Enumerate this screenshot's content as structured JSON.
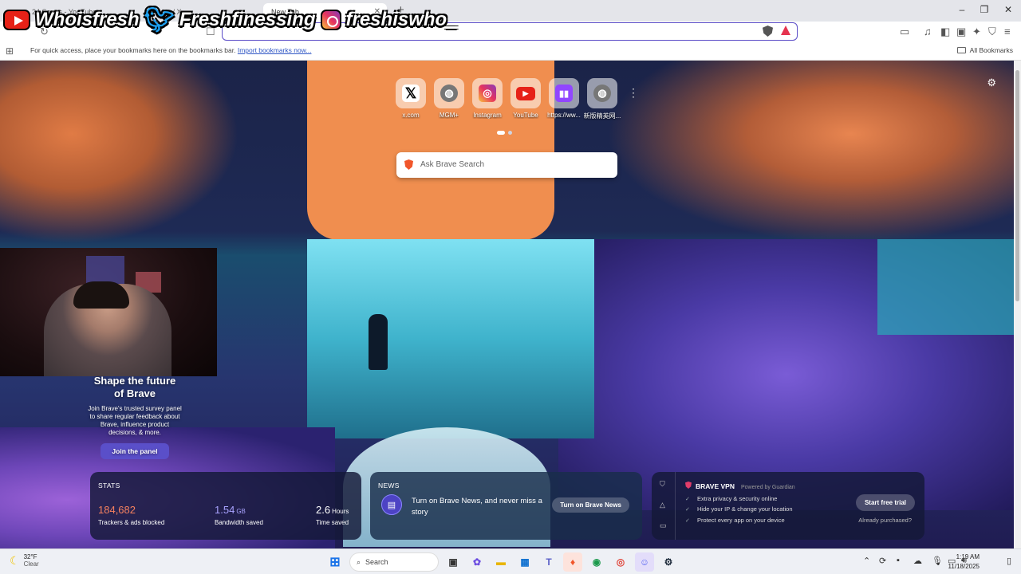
{
  "tabs": [
    {
      "title": "24 Songs - YouTube"
    },
    {
      "title": "Home / X"
    },
    {
      "title": "New Tab",
      "active": true
    }
  ],
  "bookmarks_bar": {
    "hint": "For quick access, place your bookmarks here on the bookmarks bar.",
    "import_link": "Import bookmarks now...",
    "all_bookmarks": "All Bookmarks"
  },
  "stream_overlay": {
    "youtube": "Whoisfresh",
    "twitter": "Freshfinessing",
    "instagram": "freshiswho_"
  },
  "top_sites": [
    {
      "label": "x.com",
      "icon": "x-icon"
    },
    {
      "label": "MGM+",
      "icon": "globe-icon"
    },
    {
      "label": "Instagram",
      "icon": "instagram-icon"
    },
    {
      "label": "YouTube",
      "icon": "youtube-icon"
    },
    {
      "label": "https://ww...",
      "icon": "twitch-icon"
    },
    {
      "label": "新版精英网...",
      "icon": "globe-icon"
    }
  ],
  "search": {
    "placeholder": "Ask Brave Search"
  },
  "promo": {
    "title": "Shape the future of Brave",
    "body": "Join Brave's trusted survey panel to share regular feedback about Brave, influence product decisions, & more.",
    "button": "Join the panel"
  },
  "stats": {
    "heading": "STATS",
    "trackers_value": "184,682",
    "trackers_label": "Trackers & ads blocked",
    "bandwidth_value": "1.54",
    "bandwidth_unit": "GB",
    "bandwidth_label": "Bandwidth saved",
    "time_value": "2.6",
    "time_unit": "Hours",
    "time_label": "Time saved"
  },
  "news": {
    "heading": "NEWS",
    "text": "Turn on Brave News, and never miss a story",
    "button": "Turn on Brave News"
  },
  "vpn": {
    "title": "BRAVE VPN",
    "powered": "Powered by Guardian",
    "features": [
      "Extra privacy & security online",
      "Hide your IP & change your location",
      "Protect every app on your device"
    ],
    "button": "Start free trial",
    "already": "Already purchased?"
  },
  "taskbar": {
    "temp": "32°F",
    "condition": "Clear",
    "search": "Search",
    "time": "1:19 AM",
    "date": "11/18/2025"
  },
  "colors": {
    "accent": "#5b4dc8",
    "brave_orange": "#f1562b",
    "vpn_pink": "#e13d6a"
  }
}
